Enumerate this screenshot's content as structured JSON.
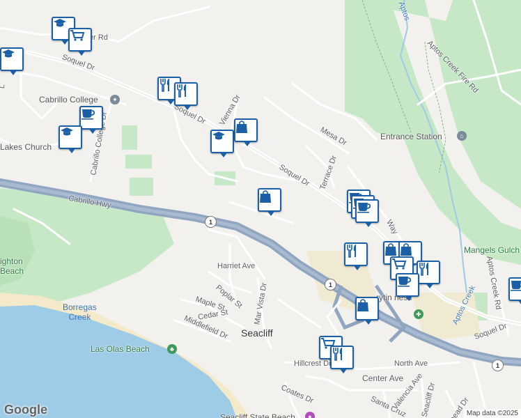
{
  "map": {
    "street_labels": [
      {
        "id": "soquel-dr-nw",
        "text": "Soquel Dr"
      },
      {
        "id": "soquel-dr-mid",
        "text": "Soquel Dr"
      },
      {
        "id": "soquel-dr-east",
        "text": "Soquel Dr"
      },
      {
        "id": "soquel-dr-se",
        "text": "Soquel Dr"
      },
      {
        "id": "vienna-dr",
        "text": "Vienna Dr"
      },
      {
        "id": "mesa-dr",
        "text": "Mesa Dr"
      },
      {
        "id": "terrace-dr",
        "text": "Terrace Dr"
      },
      {
        "id": "cabrillo-college-dr",
        "text": "Cabrillo College Dr"
      },
      {
        "id": "cabrillo-hwy",
        "text": "Cabrillo Hwy"
      },
      {
        "id": "harriet-ave",
        "text": "Harriet Ave"
      },
      {
        "id": "poplar-st",
        "text": "Poplar St"
      },
      {
        "id": "maple-st",
        "text": "Maple St"
      },
      {
        "id": "cedar-st",
        "text": "Cedar St"
      },
      {
        "id": "middlefield-dr",
        "text": "Middlefield Dr"
      },
      {
        "id": "mar-vista-dr",
        "text": "Mar Vista Dr"
      },
      {
        "id": "hillcrest-dr",
        "text": "Hillcrest Dr"
      },
      {
        "id": "north-ave",
        "text": "North Ave"
      },
      {
        "id": "center-ave",
        "text": "Center Ave"
      },
      {
        "id": "coates-dr",
        "text": "Coates Dr"
      },
      {
        "id": "santa-cruz",
        "text": "Santa Cruz"
      },
      {
        "id": "valencia-ave",
        "text": "Valencia Ave"
      },
      {
        "id": "seacliff-dr",
        "text": "Seacliff Dr"
      },
      {
        "id": "head-dr",
        "text": "head Dr"
      },
      {
        "id": "aptos-creek-fire-rd",
        "text": "Aptos Creek Fire Rd"
      },
      {
        "id": "aptos-creek-rd",
        "text": "Aptos Creek Rd"
      },
      {
        "id": "aptos-creek",
        "text": "Aptos Creek"
      },
      {
        "id": "aptos-top",
        "text": "Aptos"
      },
      {
        "id": "way",
        "text": "Way"
      },
      {
        "id": "er-rd",
        "text": "er Rd"
      },
      {
        "id": "left-edge-l",
        "text": "L"
      }
    ],
    "place_labels": [
      {
        "id": "seacliff",
        "text": "Seacliff"
      },
      {
        "id": "cabrillo-college",
        "text": "Cabrillo College"
      },
      {
        "id": "lakes-church",
        "text": "Lakes Church"
      },
      {
        "id": "entrance-station",
        "text": "Entrance Station"
      },
      {
        "id": "mangels-gulch",
        "text": "Mangels Gulch"
      },
      {
        "id": "borregas-creek",
        "text": "Borregas\nCreek"
      },
      {
        "id": "las-olas-beach",
        "text": "Las Olas Beach"
      },
      {
        "id": "seacliff-state-beach",
        "text": "Seacliff State Beach"
      },
      {
        "id": "brighton-beach",
        "text": "ighton\nBeach"
      },
      {
        "id": "rytin-ness",
        "text": "rytin ness"
      }
    ],
    "highway_shields": [
      {
        "id": "hwy1-a",
        "text": "1"
      },
      {
        "id": "hwy1-b",
        "text": "1"
      },
      {
        "id": "hwy1-c",
        "text": "1"
      }
    ],
    "markers": [
      {
        "id": "m1",
        "icon": "graduation-cap"
      },
      {
        "id": "m2",
        "icon": "shopping-cart"
      },
      {
        "id": "m3",
        "icon": "graduation-cap"
      },
      {
        "id": "m4",
        "icon": "restaurant"
      },
      {
        "id": "m5",
        "icon": "restaurant"
      },
      {
        "id": "m6",
        "icon": "coffee"
      },
      {
        "id": "m7",
        "icon": "graduation-cap"
      },
      {
        "id": "m8",
        "icon": "graduation-cap"
      },
      {
        "id": "m9",
        "icon": "shopping-bag"
      },
      {
        "id": "m10",
        "icon": "shopping-bag"
      },
      {
        "id": "m11",
        "icon": "coffee"
      },
      {
        "id": "m12",
        "icon": "coffee"
      },
      {
        "id": "m13",
        "icon": "coffee"
      },
      {
        "id": "m14",
        "icon": "restaurant"
      },
      {
        "id": "m15",
        "icon": "shopping-bag"
      },
      {
        "id": "m16",
        "icon": "shopping-bag"
      },
      {
        "id": "m17",
        "icon": "shopping-cart"
      },
      {
        "id": "m18",
        "icon": "restaurant"
      },
      {
        "id": "m19",
        "icon": "coffee"
      },
      {
        "id": "m20",
        "icon": "shopping-bag"
      },
      {
        "id": "m21",
        "icon": "shopping-cart"
      },
      {
        "id": "m22",
        "icon": "restaurant"
      },
      {
        "id": "m23",
        "icon": "coffee"
      }
    ],
    "attribution": "Map data ©2025",
    "logo": "Google",
    "colors": {
      "water": "#9ecbe6",
      "park": "#c6e8c6",
      "highway": "#8fa5c0",
      "marker_border": "#1b5fa6",
      "sand": "#f4e9c8"
    }
  }
}
